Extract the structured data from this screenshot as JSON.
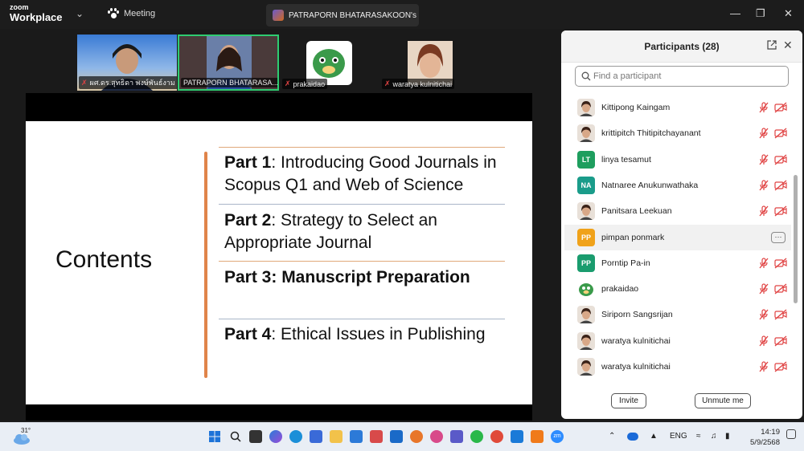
{
  "app": {
    "brand_top": "zoom",
    "brand_bottom": "Workplace",
    "meeting_label": "Meeting",
    "share_tab_title": "PATRAPORN BHATARASAKOON's"
  },
  "video_strip": [
    {
      "name": "ผศ.ดร.สุทธิดา พงษ์พันธ์งาม",
      "muted": true
    },
    {
      "name": "PATRAPORN BHATARASA...",
      "muted": false,
      "active_speaker": true
    },
    {
      "name": "prakaidao",
      "muted": true
    },
    {
      "name": "waratya kulnitichai",
      "muted": true
    }
  ],
  "slide": {
    "title": "Contents",
    "parts": [
      {
        "bold": "Part 1",
        "rest": ": Introducing Good Journals in Scopus Q1 and Web of Science"
      },
      {
        "bold": "Part 2",
        "rest": ": Strategy to Select an Appropriate Journal"
      },
      {
        "bold": "Part 3: Manuscript Preparation",
        "rest": ""
      },
      {
        "bold": "Part 4",
        "rest": ": Ethical Issues in Publishing"
      }
    ],
    "accent_color": "#e0844a"
  },
  "participants": {
    "title": "Participants (28)",
    "search_placeholder": "Find a participant",
    "list": [
      {
        "name": "Kittipong Kaingam",
        "avatar": "photo",
        "muted": true,
        "video_off": true
      },
      {
        "name": "krittipitch Thitipitchayanant",
        "avatar": "photo",
        "muted": true,
        "video_off": true
      },
      {
        "name": "linya tesamut",
        "avatar": "LT",
        "avatar_color": "#1e9e5e",
        "muted": true,
        "video_off": true
      },
      {
        "name": "Natnaree Anukunwathaka",
        "avatar": "NA",
        "avatar_color": "#1a9c8a",
        "muted": true,
        "video_off": true
      },
      {
        "name": "Panitsara Leekuan",
        "avatar": "photo",
        "muted": true,
        "video_off": true
      },
      {
        "name": "pimpan ponmark",
        "avatar": "PP",
        "avatar_color": "#f0a21a",
        "hovered": true
      },
      {
        "name": "Porntip Pa-in",
        "avatar": "PP",
        "avatar_color": "#1a9c6e",
        "muted": true,
        "video_off": true
      },
      {
        "name": "prakaidao",
        "avatar": "tiger",
        "muted": true,
        "video_off": true
      },
      {
        "name": "Siriporn Sangsrijan",
        "avatar": "photo",
        "muted": true,
        "video_off": true
      },
      {
        "name": "waratya kulnitichai",
        "avatar": "photo",
        "muted": true,
        "video_off": true
      },
      {
        "name": "waratya kulnitichai",
        "avatar": "photo",
        "muted": true,
        "video_off": true
      }
    ],
    "invite_label": "Invite",
    "unmute_label": "Unmute me"
  },
  "taskbar": {
    "temperature": "31°",
    "language": "ENG",
    "time": "14:19",
    "date": "5/9/2568"
  }
}
